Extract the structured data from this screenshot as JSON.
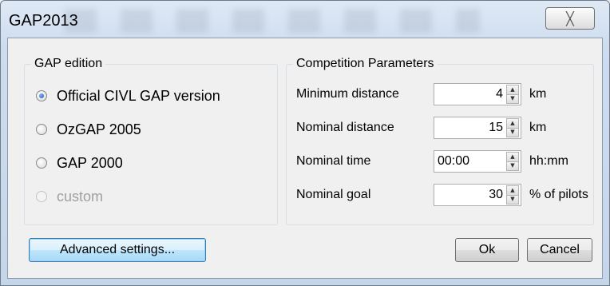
{
  "window": {
    "title": "GAP2013",
    "close_glyph": "╳"
  },
  "gap_edition": {
    "title": "GAP edition",
    "options": [
      {
        "label": "Official CIVL GAP version",
        "checked": true,
        "enabled": true
      },
      {
        "label": "OzGAP 2005",
        "checked": false,
        "enabled": true
      },
      {
        "label": "GAP 2000",
        "checked": false,
        "enabled": true
      },
      {
        "label": "custom",
        "checked": false,
        "enabled": false
      }
    ]
  },
  "competition": {
    "title": "Competition Parameters",
    "params": [
      {
        "label": "Minimum distance",
        "value": "4",
        "unit": "km"
      },
      {
        "label": "Nominal distance",
        "value": "15",
        "unit": "km"
      },
      {
        "label": "Nominal time",
        "value": "00:00",
        "unit": "hh:mm"
      },
      {
        "label": "Nominal goal",
        "value": "30",
        "unit": "% of pilots"
      }
    ]
  },
  "buttons": {
    "advanced": "Advanced settings...",
    "ok": "Ok",
    "cancel": "Cancel"
  },
  "icons": {
    "spin_up": "▲",
    "spin_down": "▼"
  }
}
